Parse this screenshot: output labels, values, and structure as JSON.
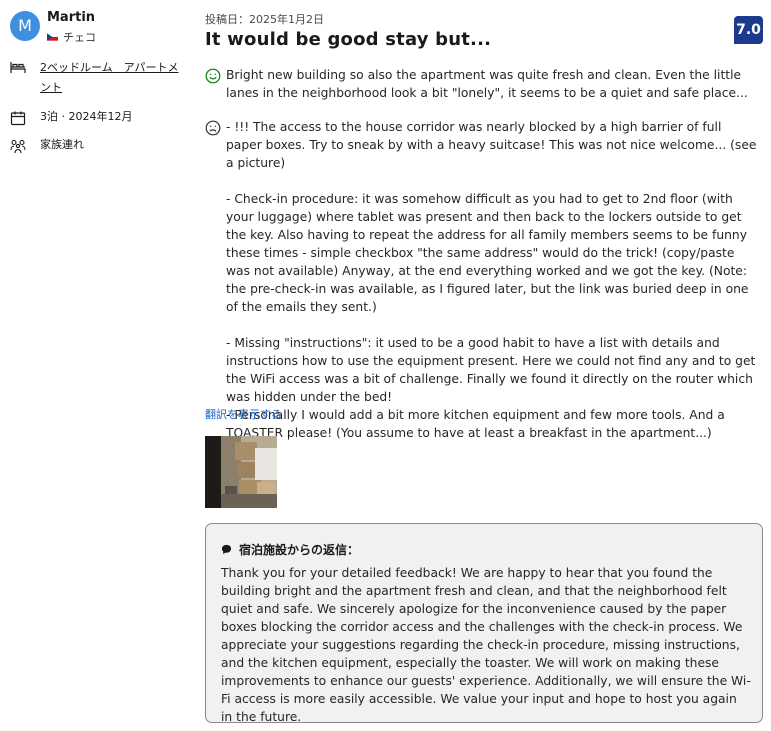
{
  "reviewer": {
    "initial": "M",
    "name": "Martin",
    "country": "チェコ"
  },
  "stay_info": {
    "room": "2ベッドルーム　アパートメント",
    "nights": "3泊 · 2024年12月",
    "traveler_type": "家族連れ"
  },
  "review": {
    "posted_date": "投稿日：2025年1月2日",
    "title": "It would be good stay but...",
    "score": "7.0",
    "positive": "Bright new building so also the apartment was quite fresh and clean. Even the little lanes in the neighborhood look a bit \"lonely\", it seems to be a quiet and safe place...",
    "negative": "- !!! The access to the house corridor was nearly blocked by a high barrier of full paper boxes. Try to sneak by with a heavy suitcase! This was not nice welcome... (see a picture)\n\n- Check-in procedure: it was somehow difficult as you had to get to 2nd floor (with your luggage) where tablet was present and then back to the lockers outside to get the key. Also having to repeat the address for all family members seems to be funny these times - simple checkbox \"the same address\" would do the trick! (copy/paste was not available) Anyway, at the end everything worked and we got the key. (Note: the pre-check-in was available, as I figured later, but the link was buried deep in one of the emails they sent.)\n\n- Missing \"instructions\": it used to be a good habit to have a list with details and instructions how to use the equipment present. Here we could not find any and to get the WiFi access was a bit of challenge. Finally we found it directly on the router which was hidden under the bed!\n- Personally I would add a bit more kitchen equipment and few more tools. And a TOASTER please! (You assume to have at least a breakfast in the apartment...)",
    "translate_link": "翻訳を表示する"
  },
  "reply": {
    "heading": "宿泊施設からの返信：",
    "body": "Thank you for your detailed feedback! We are happy to hear that you found the building bright and the apartment fresh and clean, and that the neighborhood felt quiet and safe. We sincerely apologize for the inconvenience caused by the paper boxes blocking the corridor access and the challenges with the check-in process. We appreciate your suggestions regarding the check-in procedure, missing instructions, and the kitchen equipment, especially the toaster. We will work on making these improvements to enhance our guests' experience. Additionally, we will ensure the Wi-Fi access is more easily accessible. We value your input and hope to host you again in the future."
  },
  "icons": {
    "bed": "bed-icon",
    "calendar": "calendar-icon",
    "group": "people-group-icon",
    "positive": "smile-face-icon",
    "negative": "sad-face-icon",
    "reply": "speech-bubble-icon",
    "flag": "czech-flag-icon"
  },
  "colors": {
    "avatar": "#3d8fe0",
    "score_badge": "#1c3a8e",
    "link": "#1a63c7",
    "positive_icon": "#008009"
  }
}
